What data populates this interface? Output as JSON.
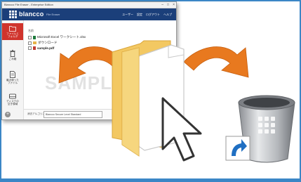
{
  "window": {
    "title": "Blancco File Eraser - Enterprise Edition",
    "controls": [
      "–",
      "□",
      "×"
    ]
  },
  "header": {
    "brand": "blancco",
    "product": "File Eraser",
    "nav": [
      "ユーザー",
      "設定",
      "ログアウト",
      "ヘルプ"
    ]
  },
  "sidebar": {
    "items": [
      {
        "label": "ファイルと\nフォルダ",
        "icon": "folder-icon",
        "active": true
      },
      {
        "label": "ごみ箱",
        "icon": "trash-icon",
        "active": false
      },
      {
        "label": "最近使った\nファイル",
        "icon": "document-icon",
        "active": false
      },
      {
        "label": "ディスクの\n空き領域",
        "icon": "disk-icon",
        "active": false
      }
    ]
  },
  "main": {
    "column_header": "名前",
    "files": [
      {
        "name": "Microsoft Excel ワークシート.xlsx",
        "icon": "excel-file-icon",
        "color": "#1e7a3c"
      },
      {
        "name": "ダウンロード",
        "icon": "folder-icon",
        "color": "#e7b34a"
      },
      {
        "name": "sample.pdf",
        "icon": "pdf-file-icon",
        "color": "#c23b32"
      }
    ],
    "watermark": "SAMPLE"
  },
  "footer": {
    "label": "消去アルゴリズム",
    "select_value": "Blancco Secure Level Standard",
    "add_symbol": "+"
  },
  "colors": {
    "frame": "#3b86c6",
    "brand_bar": "#1b3f7a",
    "accent": "#d0342c",
    "arrow": "#e8791f",
    "folder": "#f3c862"
  },
  "illustration": {
    "elements": [
      "left-arrow",
      "right-arrow",
      "folder-with-document",
      "mouse-cursor",
      "recycle-bin",
      "shortcut-badge"
    ]
  }
}
